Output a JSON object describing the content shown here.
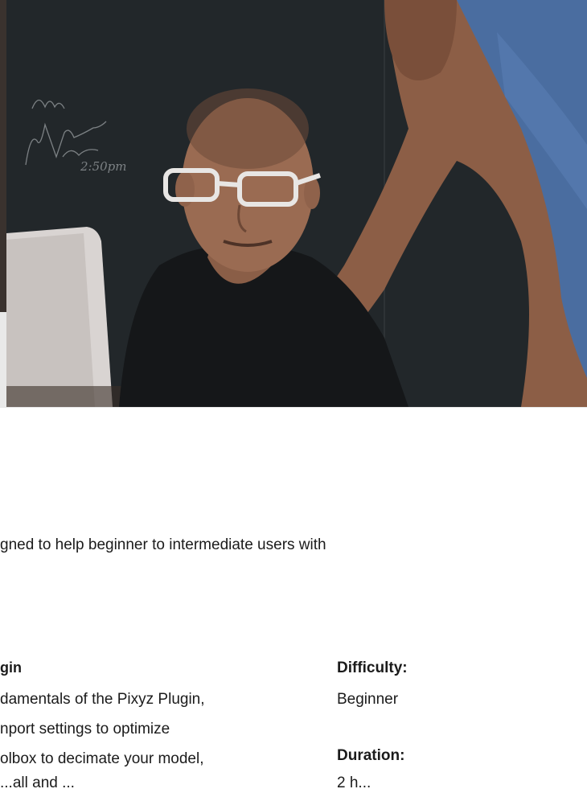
{
  "hero": {
    "image": "photo-two-people-working-at-laptop",
    "chalkboard_text": [
      "Vugi",
      "JWT-bu...",
      "2:50pm"
    ]
  },
  "intro": {
    "text": "gned to help beginner to intermediate users with"
  },
  "course": {
    "title_fragment": "gin",
    "description_lines": [
      "damentals of the Pixyz Plugin,",
      "nport settings to optimize",
      "olbox to decimate your model,",
      "...all and ..."
    ]
  },
  "meta": {
    "difficulty_label": "Difficulty:",
    "difficulty_value": "Beginner",
    "duration_label": "Duration:",
    "duration_value": "2 h..."
  },
  "colors": {
    "text": "#1b1b1b",
    "chalkboard": "#262a2d",
    "shirt_blue": "#4a6da0"
  }
}
